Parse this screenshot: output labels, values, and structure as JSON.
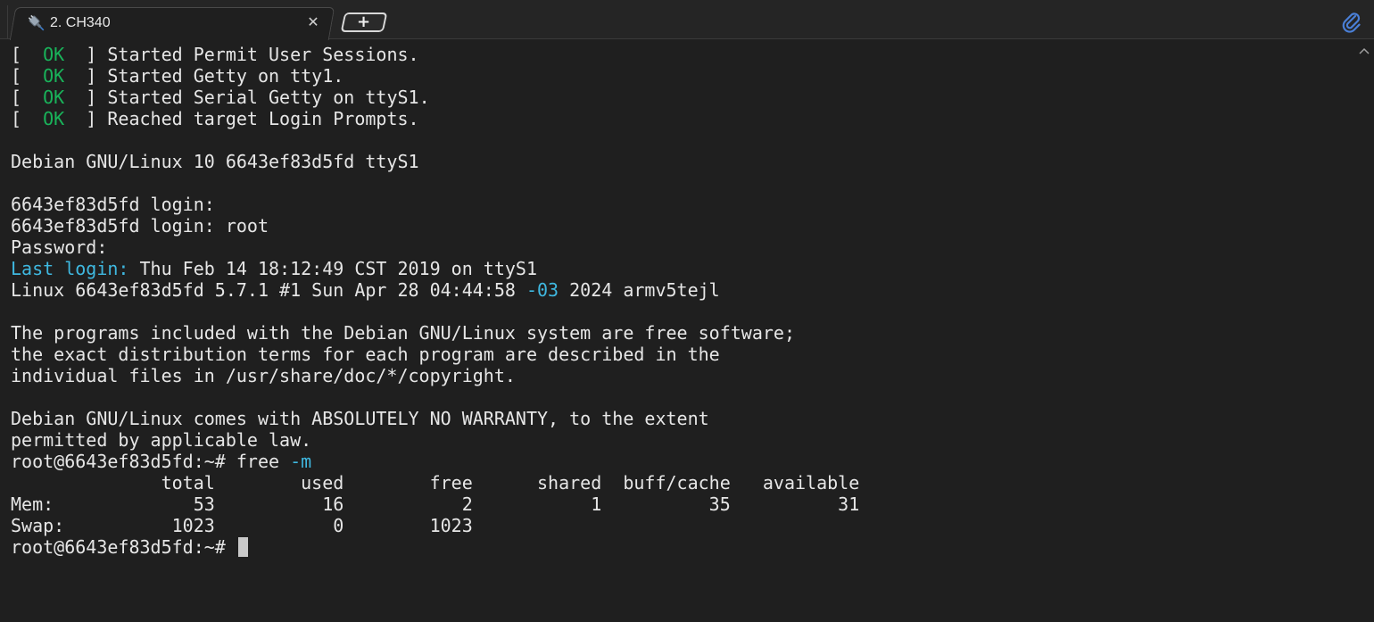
{
  "tab": {
    "title": "2. CH340",
    "icon": "plug-icon",
    "close_icon": "close-icon"
  },
  "new_tab": {
    "icon": "plus-icon",
    "label": "+"
  },
  "toolbar": {
    "attach_icon": "paperclip-icon"
  },
  "colors": {
    "ok": "#19b35a",
    "highlight": "#3fb8e0",
    "text": "#e6e6e6",
    "background": "#1f1f1f"
  },
  "terminal": {
    "boot": [
      {
        "prefix": "[  ",
        "status": "OK",
        "suffix": "  ] Started Permit User Sessions."
      },
      {
        "prefix": "[  ",
        "status": "OK",
        "suffix": "  ] Started Getty on tty1."
      },
      {
        "prefix": "[  ",
        "status": "OK",
        "suffix": "  ] Started Serial Getty on ttyS1."
      },
      {
        "prefix": "[  ",
        "status": "OK",
        "suffix": "  ] Reached target Login Prompts."
      }
    ],
    "banner": "Debian GNU/Linux 10 6643ef83d5fd ttyS1",
    "login_prompt_1": "6643ef83d5fd login:",
    "login_prompt_2": "6643ef83d5fd login: root",
    "password_prompt": "Password:",
    "last_login_label": "Last login:",
    "last_login_value": " Thu Feb 14 18:12:49 CST 2019 on ttyS1",
    "uname_before": "Linux 6643ef83d5fd 5.7.1 #1 Sun Apr 28 04:44:58 ",
    "uname_tz": "-03",
    "uname_after": " 2024 armv5tejl",
    "motd": [
      "The programs included with the Debian GNU/Linux system are free software;",
      "the exact distribution terms for each program are described in the",
      "individual files in /usr/share/doc/*/copyright."
    ],
    "warranty": [
      "Debian GNU/Linux comes with ABSOLUTELY NO WARRANTY, to the extent",
      "permitted by applicable law."
    ],
    "command_prompt": "root@6643ef83d5fd:~# free ",
    "command_flag": "-m",
    "free_header": "              total        used        free      shared  buff/cache   available",
    "free_mem": "Mem:             53          16           2           1          35          31",
    "free_swap": "Swap:          1023           0        1023",
    "final_prompt": "root@6643ef83d5fd:~# "
  }
}
